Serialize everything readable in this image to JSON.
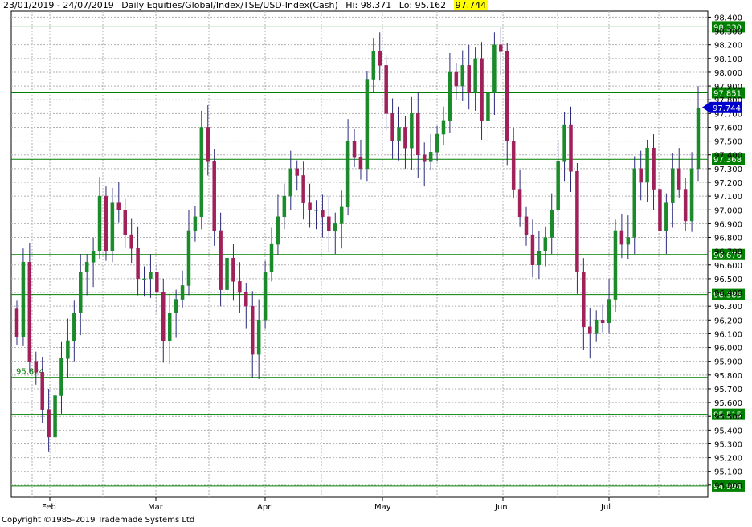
{
  "header": {
    "date_range": "23/01/2019 - 24/07/2019",
    "instrument": "Daily  Equities/Global/Index/TSE/USD-Index(Cash)",
    "hi_label": "Hi: 98.371",
    "lo_label": "Lo: 95.162",
    "last_value": "97.744"
  },
  "footer": {
    "copyright": "Copyright ©1985-2019 Trademade Systems Ltd"
  },
  "colors": {
    "up_candle": "#1a8a2a",
    "down_candle": "#a0205a",
    "wick": "#2a2a7a",
    "sr_line": "#008000",
    "last_marker": "#0000cc",
    "grid": "#b0b0b0"
  },
  "chart_data": {
    "type": "candlestick",
    "x_months": [
      "Feb",
      "Mar",
      "Apr",
      "May",
      "Jun",
      "Jul"
    ],
    "y_ticks": [
      "98.400",
      "98.300",
      "98.200",
      "98.100",
      "98.000",
      "97.900",
      "97.800",
      "97.700",
      "97.600",
      "97.500",
      "97.400",
      "97.300",
      "97.200",
      "97.100",
      "97.000",
      "96.900",
      "96.800",
      "96.700",
      "96.600",
      "96.500",
      "96.400",
      "96.300",
      "96.200",
      "96.100",
      "96.000",
      "95.900",
      "95.800",
      "95.700",
      "95.600",
      "95.500",
      "95.400",
      "95.300",
      "95.200",
      "95.100",
      "95.000"
    ],
    "ylim": [
      94.97,
      98.42
    ],
    "horizontal_levels": [
      "98.330",
      "97.851",
      "97.368",
      "96.676",
      "96.385",
      "95.515",
      "94.994"
    ],
    "level_95824": "95.824",
    "last_price": "97.744",
    "hi": 98.371,
    "lo": 95.162,
    "close_series": [
      96.08,
      96.62,
      95.9,
      95.82,
      95.55,
      95.35,
      95.65,
      95.92,
      96.05,
      96.25,
      96.55,
      96.62,
      96.7,
      97.1,
      96.7,
      97.05,
      97.0,
      96.82,
      96.72,
      96.5,
      96.5,
      96.55,
      96.4,
      96.05,
      96.25,
      96.35,
      96.45,
      96.85,
      96.95,
      97.6,
      97.35,
      96.85,
      96.42,
      96.65,
      96.48,
      96.4,
      96.3,
      95.95,
      96.2,
      96.55,
      96.75,
      96.95,
      97.1,
      97.3,
      97.25,
      97.05,
      97.0,
      97.0,
      96.95,
      96.85,
      96.9,
      97.02,
      97.5,
      97.38,
      97.3,
      97.95,
      98.15,
      98.05,
      97.7,
      97.5,
      97.6,
      97.45,
      97.7,
      97.4,
      97.35,
      97.42,
      97.55,
      97.65,
      98.0,
      97.9,
      98.05,
      97.85,
      98.1,
      97.65,
      97.85,
      98.2,
      98.15,
      97.5,
      97.15,
      96.95,
      96.82,
      96.6,
      96.7,
      96.8,
      97.0,
      97.35,
      97.62,
      97.28,
      96.55,
      96.15,
      96.1,
      96.2,
      96.18,
      96.35,
      96.85,
      96.75,
      96.8,
      97.3,
      97.2,
      97.45,
      97.15,
      96.85,
      97.05,
      97.3,
      97.15,
      96.92,
      97.3,
      97.74
    ]
  }
}
